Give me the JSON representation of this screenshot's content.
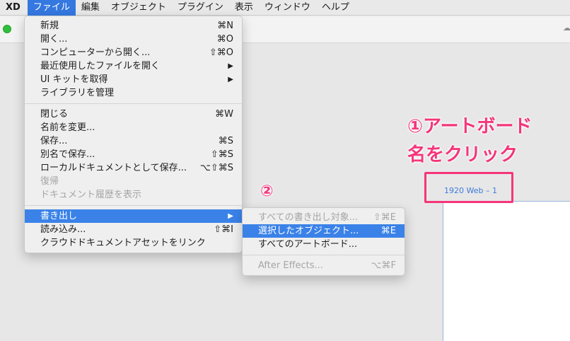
{
  "menubar": {
    "app": "XD",
    "items": [
      "ファイル",
      "編集",
      "オブジェクト",
      "プラグイン",
      "表示",
      "ウィンドウ",
      "ヘルプ"
    ],
    "active_index": 0
  },
  "file_menu": {
    "group1": [
      {
        "label": "新規",
        "shortcut": "⌘N"
      },
      {
        "label": "開く...",
        "shortcut": "⌘O"
      },
      {
        "label": "コンピューターから開く...",
        "shortcut": "⇧⌘O"
      },
      {
        "label": "最近使用したファイルを開く",
        "shortcut": "▶"
      },
      {
        "label": "UI キットを取得",
        "shortcut": "▶"
      },
      {
        "label": "ライブラリを管理",
        "shortcut": ""
      }
    ],
    "group2": [
      {
        "label": "閉じる",
        "shortcut": "⌘W"
      },
      {
        "label": "名前を変更...",
        "shortcut": ""
      },
      {
        "label": "保存...",
        "shortcut": "⌘S"
      },
      {
        "label": "別名で保存...",
        "shortcut": "⇧⌘S"
      },
      {
        "label": "ローカルドキュメントとして保存...",
        "shortcut": "⌥⇧⌘S"
      },
      {
        "label": "復帰",
        "shortcut": ""
      },
      {
        "label": "ドキュメント履歴を表示",
        "shortcut": ""
      }
    ],
    "group3": [
      {
        "label": "書き出し",
        "shortcut": "▶"
      },
      {
        "label": "読み込み...",
        "shortcut": "⇧⌘I"
      },
      {
        "label": "クラウドドキュメントアセットをリンク",
        "shortcut": ""
      }
    ]
  },
  "export_menu": {
    "items": [
      {
        "label": "すべての書き出し対象...",
        "shortcut": "⇧⌘E"
      },
      {
        "label": "選択したオブジェクト...",
        "shortcut": "⌘E"
      },
      {
        "label": "すべてのアートボード...",
        "shortcut": ""
      }
    ],
    "after_effects": {
      "label": "After Effects...",
      "shortcut": "⌥⌘F"
    }
  },
  "canvas": {
    "artboard_label": "1920 Web – 1"
  },
  "annotations": {
    "step1_line1": "①アートボード",
    "step1_line2": "名をクリック",
    "step2": "②"
  },
  "colors": {
    "accent": "#3a82e8",
    "annotation": "#f5357a"
  }
}
